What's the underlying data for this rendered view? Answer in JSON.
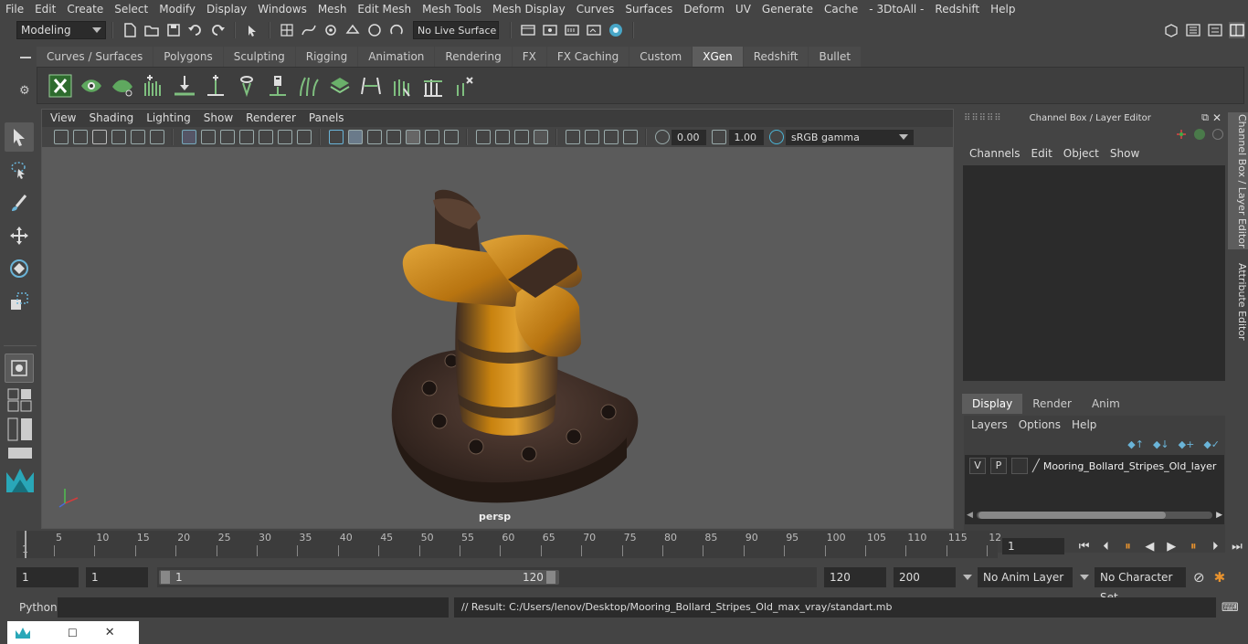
{
  "menu": [
    "File",
    "Edit",
    "Create",
    "Select",
    "Modify",
    "Display",
    "Windows",
    "Mesh",
    "Edit Mesh",
    "Mesh Tools",
    "Mesh Display",
    "Curves",
    "Surfaces",
    "Deform",
    "UV",
    "Generate",
    "Cache",
    "- 3DtoAll -",
    "Redshift",
    "Help"
  ],
  "status": {
    "workspace": "Modeling",
    "live_surface": "No Live Surface"
  },
  "shelf": {
    "tabs": [
      "Curves / Surfaces",
      "Polygons",
      "Sculpting",
      "Rigging",
      "Animation",
      "Rendering",
      "FX",
      "FX Caching",
      "Custom",
      "XGen",
      "Redshift",
      "Bullet"
    ],
    "active_tab": "XGen",
    "icon_names": [
      "xgen-x-icon",
      "eye-icon",
      "leaf-icon",
      "comb-add-icon",
      "place-guide-icon",
      "add-guide-icon",
      "sculpt-guide-icon",
      "lock-guide-icon",
      "grass-icon",
      "layers-icon",
      "bend-icon",
      "brush-guide-icon",
      "cut-icon",
      "spray-icon"
    ]
  },
  "viewport": {
    "menu": [
      "View",
      "Shading",
      "Lighting",
      "Show",
      "Renderer",
      "Panels"
    ],
    "exposure": "0.00",
    "gamma": "1.00",
    "color_space": "sRGB gamma",
    "camera_label": "persp"
  },
  "channel_box": {
    "title": "Channel Box / Layer Editor",
    "menu": [
      "Channels",
      "Edit",
      "Object",
      "Show"
    ]
  },
  "layer_editor": {
    "tabs": [
      "Display",
      "Render",
      "Anim"
    ],
    "active_tab": "Display",
    "menu": [
      "Layers",
      "Options",
      "Help"
    ],
    "layer": {
      "v": "V",
      "p": "P",
      "name": "Mooring_Bollard_Stripes_Old_layer"
    }
  },
  "side_tabs": [
    "Channel Box / Layer Editor",
    "Attribute Editor"
  ],
  "time_slider": {
    "ticks": [
      "5",
      "10",
      "15",
      "20",
      "25",
      "30",
      "35",
      "40",
      "45",
      "50",
      "55",
      "60",
      "65",
      "70",
      "75",
      "80",
      "85",
      "90",
      "95",
      "100",
      "105",
      "110",
      "115",
      "12"
    ],
    "start_label": "1",
    "current_frame": "1"
  },
  "range": {
    "start": "1",
    "playback_start": "1",
    "slider_start": "1",
    "slider_end": "120",
    "playback_end": "120",
    "end": "200",
    "anim_layer": "No Anim Layer",
    "character_set": "No Character Set"
  },
  "command": {
    "language": "Python",
    "result": "// Result: C:/Users/lenov/Desktop/Mooring_Bollard_Stripes_Old_max_vray/standart.mb"
  },
  "colors": {
    "accent": "#5d5d5d",
    "field": "#2b2b2b",
    "bollard_orange": "#c8820f",
    "bollard_dark": "#3a2a22"
  }
}
